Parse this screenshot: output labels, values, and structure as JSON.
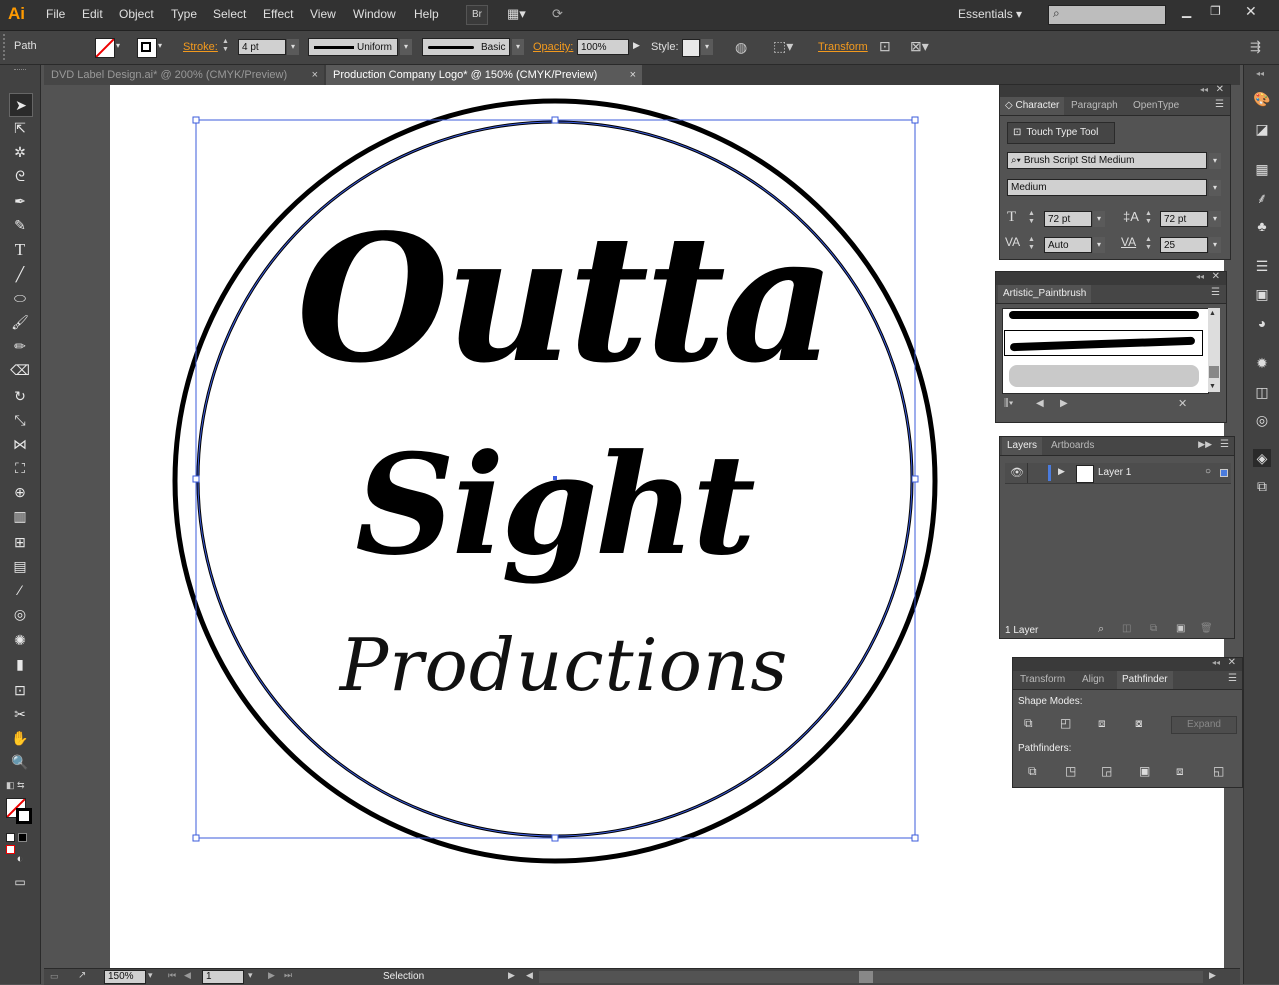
{
  "app": {
    "logo": "Ai"
  },
  "menu": [
    "File",
    "Edit",
    "Object",
    "Type",
    "Select",
    "Effect",
    "View",
    "Window",
    "Help"
  ],
  "menubar": {
    "bridge_label": "Br",
    "workspace": "Essentials"
  },
  "control": {
    "selection_type": "Path",
    "stroke_label": "Stroke:",
    "stroke_value": "4 pt",
    "profile": "Uniform",
    "brush": "Basic",
    "opacity_label": "Opacity:",
    "opacity_value": "100%",
    "style_label": "Style:",
    "transform_label": "Transform"
  },
  "tabs": [
    {
      "label": "DVD Label Design.ai* @ 200% (CMYK/Preview)",
      "close": "×"
    },
    {
      "label": "Production Company Logo* @ 150% (CMYK/Preview)",
      "close": "×"
    }
  ],
  "artwork": {
    "line1": "Outta",
    "line2": "Sight",
    "line3": "Productions"
  },
  "character": {
    "tabs": [
      "Character",
      "Paragraph",
      "OpenType"
    ],
    "touch_type": "Touch Type Tool",
    "font": "Brush Script Std Medium",
    "style": "Medium",
    "size": "72 pt",
    "leading": "72 pt",
    "kerning": "Auto",
    "tracking": "25"
  },
  "brushes": {
    "tab": "Artistic_Paintbrush"
  },
  "layers": {
    "tabs": [
      "Layers",
      "Artboards"
    ],
    "layer_name": "Layer 1",
    "count": "1 Layer"
  },
  "pathfinder": {
    "tabs": [
      "Transform",
      "Align",
      "Pathfinder"
    ],
    "shape_modes": "Shape Modes:",
    "expand": "Expand",
    "pathfinders": "Pathfinders:"
  },
  "status": {
    "zoom": "150%",
    "page": "1",
    "tool": "Selection"
  },
  "colors": {
    "accent": "#f39a1e",
    "selection": "#3b5bdb",
    "panel": "#535353"
  }
}
